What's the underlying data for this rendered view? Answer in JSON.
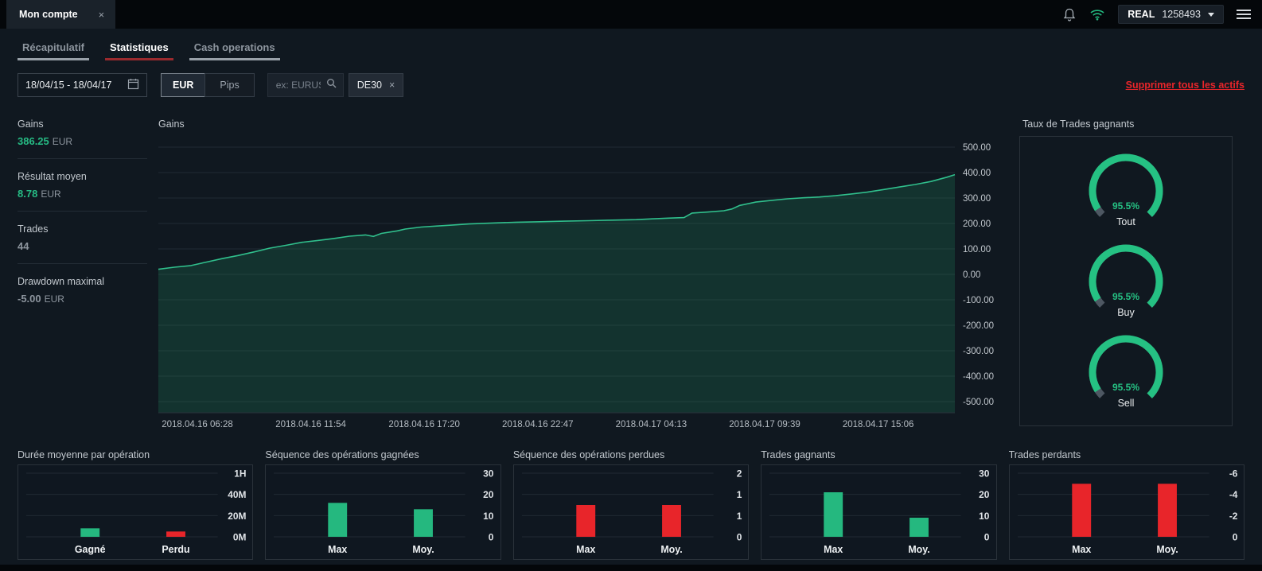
{
  "colors": {
    "green": "#25b87f",
    "red": "#e8252a",
    "background": "#101820",
    "panel_border": "#2a323a",
    "active_tab_underline": "#9b2a2e"
  },
  "icons": {
    "close": "×",
    "bell": "bell",
    "wifi": "wifi",
    "menu": "hamburger",
    "calendar": "calendar",
    "search": "magnifier",
    "caret": "caret-down"
  },
  "titlebar": {
    "tab_title": "Mon compte",
    "close_icon": "×",
    "account_type": "REAL",
    "account_number": "1258493"
  },
  "nav_tabs": [
    {
      "label": "Récapitulatif",
      "active": false
    },
    {
      "label": "Statistiques",
      "active": true
    },
    {
      "label": "Cash operations",
      "active": false
    }
  ],
  "filters": {
    "date_range": "18/04/15 - 18/04/17",
    "unit_toggle": [
      {
        "label": "EUR",
        "active": true
      },
      {
        "label": "Pips",
        "active": false
      }
    ],
    "search_placeholder": "ex: EURUSD",
    "asset_tag": "DE30",
    "asset_tag_close": "×",
    "remove_all_link": "Supprimer tous les actifs"
  },
  "summary_stats": [
    {
      "label": "Gains",
      "value": "386.25",
      "unit": "EUR",
      "color": "green"
    },
    {
      "label": "Résultat moyen",
      "value": "8.78",
      "unit": "EUR",
      "color": "green"
    },
    {
      "label": "Trades",
      "value": "44",
      "unit": "",
      "color": "gray"
    },
    {
      "label": "Drawdown maximal",
      "value": "-5.00",
      "unit": "EUR",
      "color": "gray"
    }
  ],
  "chart_data": [
    {
      "id": "gains-curve",
      "type": "area",
      "title": "Gains",
      "ylim": [
        -500,
        500
      ],
      "grid": true,
      "y_ticks": [
        "500.00",
        "400.00",
        "300.00",
        "200.00",
        "100.00",
        "0.00",
        "-100.00",
        "-200.00",
        "-300.00",
        "-400.00",
        "-500.00"
      ],
      "x_ticks": [
        "2018.04.16 06:28",
        "2018.04.16 11:54",
        "2018.04.16 17:20",
        "2018.04.16 22:47",
        "2018.04.17 04:13",
        "2018.04.17 09:39",
        "2018.04.17 15:06"
      ],
      "points": [
        [
          0,
          20
        ],
        [
          2,
          28
        ],
        [
          4,
          34
        ],
        [
          6,
          48
        ],
        [
          8,
          62
        ],
        [
          10,
          74
        ],
        [
          12,
          88
        ],
        [
          14,
          103
        ],
        [
          16,
          114
        ],
        [
          18,
          126
        ],
        [
          20,
          133
        ],
        [
          22,
          141
        ],
        [
          24,
          150
        ],
        [
          26,
          155
        ],
        [
          27,
          149
        ],
        [
          28,
          161
        ],
        [
          30,
          171
        ],
        [
          31,
          178
        ],
        [
          33,
          186
        ],
        [
          35,
          190
        ],
        [
          37,
          194
        ],
        [
          39,
          198
        ],
        [
          42,
          202
        ],
        [
          45,
          205
        ],
        [
          48,
          207
        ],
        [
          51,
          209
        ],
        [
          54,
          211
        ],
        [
          57,
          213
        ],
        [
          60,
          215
        ],
        [
          62,
          218
        ],
        [
          64,
          221
        ],
        [
          66,
          223
        ],
        [
          67,
          241
        ],
        [
          69,
          245
        ],
        [
          71,
          250
        ],
        [
          72,
          257
        ],
        [
          73,
          271
        ],
        [
          75,
          284
        ],
        [
          77,
          291
        ],
        [
          79,
          297
        ],
        [
          81,
          301
        ],
        [
          83,
          304
        ],
        [
          85,
          309
        ],
        [
          87,
          316
        ],
        [
          89,
          323
        ],
        [
          91,
          333
        ],
        [
          93,
          343
        ],
        [
          95,
          353
        ],
        [
          97,
          365
        ],
        [
          99,
          382
        ],
        [
          100,
          392
        ]
      ]
    },
    {
      "id": "win-rate-gauges",
      "type": "gauge",
      "title": "Taux de Trades gagnants",
      "gauges": [
        {
          "label": "Tout",
          "value": 95.5,
          "display": "95.5%"
        },
        {
          "label": "Buy",
          "value": 95.5,
          "display": "95.5%"
        },
        {
          "label": "Sell",
          "value": 95.5,
          "display": "95.5%"
        }
      ]
    },
    {
      "id": "avg-duration",
      "type": "bar",
      "title": "Durée moyenne par opération",
      "categories": [
        "Gagné",
        "Perdu"
      ],
      "values": [
        8,
        5
      ],
      "value_unit": "minutes",
      "scale_max": 60,
      "y_ticks": [
        "1H",
        "40M",
        "20M",
        "0M"
      ],
      "bar_colors": [
        "green",
        "red"
      ]
    },
    {
      "id": "win-sequence",
      "type": "bar",
      "title": "Séquence des opérations gagnées",
      "categories": [
        "Max",
        "Moy."
      ],
      "values": [
        16,
        13
      ],
      "scale_max": 30,
      "y_ticks": [
        "30",
        "20",
        "10",
        "0"
      ],
      "bar_colors": [
        "green",
        "green"
      ]
    },
    {
      "id": "loss-sequence",
      "type": "bar",
      "title": "Séquence des opérations perdues",
      "categories": [
        "Max",
        "Moy."
      ],
      "values": [
        1,
        1
      ],
      "scale_max": 2,
      "y_ticks": [
        "2",
        "1",
        "1",
        "0"
      ],
      "bar_colors": [
        "red",
        "red"
      ]
    },
    {
      "id": "winning-trades",
      "type": "bar",
      "title": "Trades gagnants",
      "categories": [
        "Max",
        "Moy."
      ],
      "values": [
        21,
        9
      ],
      "scale_max": 30,
      "y_ticks": [
        "30",
        "20",
        "10",
        "0"
      ],
      "bar_colors": [
        "green",
        "green"
      ]
    },
    {
      "id": "losing-trades",
      "type": "bar",
      "title": "Trades perdants",
      "categories": [
        "Max",
        "Moy."
      ],
      "values": [
        -5,
        -5
      ],
      "scale_max": 6,
      "y_ticks": [
        "-6",
        "-4",
        "-2",
        "0"
      ],
      "bar_colors": [
        "red",
        "red"
      ]
    }
  ]
}
